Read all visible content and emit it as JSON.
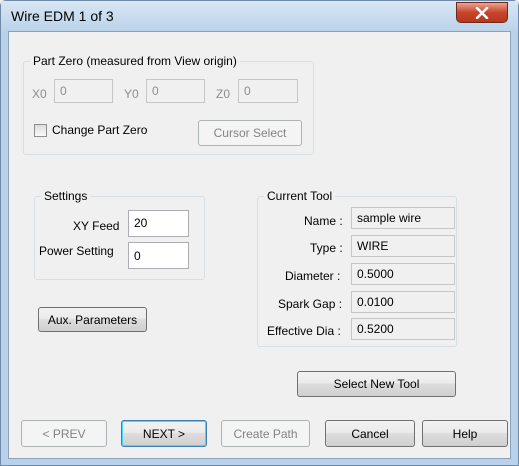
{
  "window": {
    "title": "Wire EDM 1 of 3",
    "close_symbol": "✕"
  },
  "part_zero": {
    "legend": "Part Zero (measured from View origin)",
    "x_label": "X0",
    "x_value": "0",
    "y_label": "Y0",
    "y_value": "0",
    "z_label": "Z0",
    "z_value": "0",
    "change_label": "Change Part Zero",
    "cursor_select_label": "Cursor Select"
  },
  "settings": {
    "legend": "Settings",
    "xy_feed_label": "XY Feed",
    "xy_feed_value": "20",
    "power_label": "Power Setting",
    "power_value": "0"
  },
  "aux_button_label": "Aux. Parameters",
  "current_tool": {
    "legend": "Current Tool",
    "name_label": "Name :",
    "name_value": "sample wire",
    "type_label": "Type :",
    "type_value": "WIRE",
    "diameter_label": "Diameter :",
    "diameter_value": "0.5000",
    "spark_gap_label": "Spark Gap :",
    "spark_gap_value": "0.0100",
    "effective_dia_label": "Effective Dia :",
    "effective_dia_value": "0.5200"
  },
  "select_new_tool_label": "Select New Tool",
  "footer": {
    "prev_label": "< PREV",
    "next_label": "NEXT >",
    "create_path_label": "Create Path",
    "cancel_label": "Cancel",
    "help_label": "Help"
  }
}
